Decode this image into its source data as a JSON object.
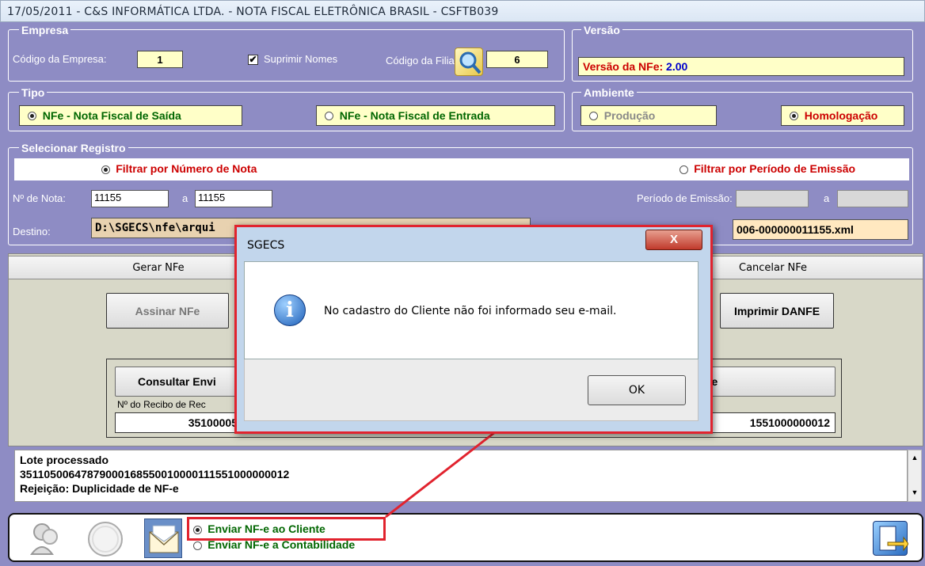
{
  "window": {
    "title": "17/05/2011  -  C&S INFORMÁTICA LTDA.  -  NOTA FISCAL ELETRÔNICA BRASIL  -  CSFTB039"
  },
  "empresa": {
    "legend": "Empresa",
    "codigo_label": "Código da Empresa:",
    "codigo_value": "1",
    "suprimir_label": "Suprimir Nomes",
    "suprimir_checked": true,
    "filial_label": "Código da Filial:",
    "filial_value": "6"
  },
  "versao": {
    "legend": "Versão",
    "label": "Versão da NFe:",
    "value": "2.00"
  },
  "tipo": {
    "legend": "Tipo",
    "saida": "NFe - Nota Fiscal de Saída",
    "entrada": "NFe - Nota Fiscal de Entrada"
  },
  "ambiente": {
    "legend": "Ambiente",
    "producao": "Produção",
    "homologacao": "Homologação"
  },
  "registro": {
    "legend": "Selecionar Registro",
    "filtro_numero": "Filtrar por Número de Nota",
    "filtro_periodo": "Filtrar por Período de Emissão",
    "nota_label": "Nº de Nota:",
    "nota_de": "11155",
    "a1": "a",
    "nota_ate": "11155",
    "periodo_label": "Período de Emissão:",
    "a2": "a",
    "destino_label": "Destino:",
    "destino_value": "D:\\SGECS\\nfe\\arqui",
    "arquivo_value": "006-000000011155.xml"
  },
  "tabs": {
    "gerar": "Gerar NFe",
    "cancelar": "Cancelar NFe"
  },
  "actions": {
    "assinar": "Assinar NFe",
    "imprimir": "Imprimir DANFE",
    "consultar": "Consultar Envi",
    "fe_partial": "Fe",
    "recibo_label": "Nº do Recibo de Rec",
    "recibo_value": "35100005",
    "chave_value": "1551000000012"
  },
  "log": {
    "line1": "Lote processado",
    "line2": "35110500647879000168550010000111551000000012",
    "line3": "Rejeição: Duplicidade de NF-e"
  },
  "envio": {
    "cliente": "Enviar NF-e ao Cliente",
    "contabilidade": "Enviar NF-e a Contabilidade"
  },
  "dialog": {
    "title": "SGECS",
    "message": "No cadastro do Cliente não foi informado seu e-mail.",
    "ok": "OK",
    "close": "X"
  },
  "colors": {
    "frame": "#8e8cc4",
    "red": "#cc0000",
    "green": "#006600",
    "highlight": "#e1232e"
  }
}
